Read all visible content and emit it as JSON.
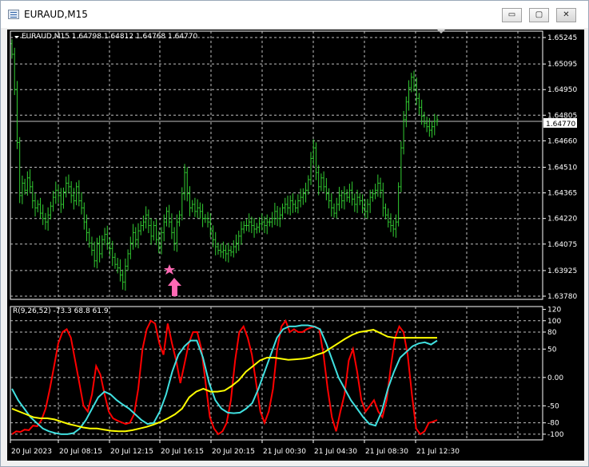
{
  "window": {
    "title": "EURAUD,M15"
  },
  "title_buttons": {
    "minimize": "▭",
    "maximize": "▢",
    "close": "✕"
  },
  "price_chart": {
    "header": "EURAUD,M15  1.64798 1.64812 1.64768 1.64770",
    "current_price": "1.64770",
    "price_labels": [
      "1.65245",
      "1.65095",
      "1.64950",
      "1.64805",
      "1.64660",
      "1.64510",
      "1.64365",
      "1.64220",
      "1.64075",
      "1.63925",
      "1.63780"
    ],
    "price_min": 1.6378,
    "price_max": 1.65245,
    "series_color": "#32cd32",
    "arrow_color": "#ff69b4",
    "close_series": [
      1.6515,
      1.6495,
      1.6465,
      1.6435,
      1.6442,
      1.6438,
      1.6445,
      1.644,
      1.6432,
      1.6428,
      1.643,
      1.6425,
      1.6422,
      1.642,
      1.6424,
      1.6429,
      1.6434,
      1.6438,
      1.6435,
      1.643,
      1.6437,
      1.6442,
      1.644,
      1.6435,
      1.6432,
      1.644,
      1.6432,
      1.6428,
      1.642,
      1.6414,
      1.6408,
      1.6404,
      1.6398,
      1.6408,
      1.6402,
      1.641,
      1.6413,
      1.6408,
      1.6405,
      1.64,
      1.6396,
      1.6394,
      1.639,
      1.6386,
      1.6395,
      1.6402,
      1.6408,
      1.6414,
      1.641,
      1.6415,
      1.6418,
      1.642,
      1.6424,
      1.6418,
      1.6412,
      1.6418,
      1.641,
      1.6406,
      1.6414,
      1.642,
      1.6426,
      1.642,
      1.6414,
      1.6408,
      1.642,
      1.6424,
      1.6436,
      1.6448,
      1.6436,
      1.6428,
      1.643,
      1.6426,
      1.6428,
      1.6426,
      1.6422,
      1.6422,
      1.642,
      1.6415,
      1.641,
      1.6406,
      1.6404,
      1.6403,
      1.6404,
      1.6402,
      1.6404,
      1.6403,
      1.6406,
      1.6408,
      1.6412,
      1.6416,
      1.6418,
      1.6418,
      1.642,
      1.6418,
      1.6416,
      1.6417,
      1.6419,
      1.642,
      1.6418,
      1.642,
      1.642,
      1.6422,
      1.6426,
      1.6422,
      1.6424,
      1.6428,
      1.643,
      1.6428,
      1.6432,
      1.643,
      1.6428,
      1.6432,
      1.6434,
      1.6436,
      1.6438,
      1.6444,
      1.6456,
      1.6462,
      1.6448,
      1.644,
      1.6445,
      1.644,
      1.6436,
      1.6432,
      1.6428,
      1.6425,
      1.643,
      1.6435,
      1.6432,
      1.6436,
      1.6434,
      1.6438,
      1.6433,
      1.643,
      1.6434,
      1.6432,
      1.6428,
      1.6426,
      1.643,
      1.6434,
      1.6436,
      1.6438,
      1.6442,
      1.6438,
      1.6428,
      1.6424,
      1.642,
      1.6418,
      1.6416,
      1.642,
      1.644,
      1.6462,
      1.6478,
      1.6488,
      1.6496,
      1.6502,
      1.6497,
      1.649,
      1.6485,
      1.648,
      1.6476,
      1.6474,
      1.6472,
      1.6474,
      1.6477,
      1.6478
    ]
  },
  "time_axis": {
    "labels": [
      "20 Jul 2023",
      "20 Jul 08:15",
      "20 Jul 12:15",
      "20 Jul 16:15",
      "20 Jul 20:15",
      "21 Jul 00:30",
      "21 Jul 04:30",
      "21 Jul 08:30",
      "21 Jul 12:30"
    ]
  },
  "indicator": {
    "header": "R(9,26,52) -73.3 68.8 61.9",
    "level_labels": [
      "120",
      "100",
      "80",
      "50",
      "0.00",
      "-50",
      "-80",
      "-100"
    ],
    "level_values": [
      120,
      100,
      80,
      50,
      0,
      -50,
      -80,
      -100
    ],
    "y_min": -110,
    "y_max": 125,
    "series": [
      {
        "color": "#ff0000",
        "values": [
          -100,
          -95,
          -96,
          -92,
          -93,
          -85,
          -86,
          -75,
          -55,
          -20,
          20,
          60,
          80,
          85,
          70,
          30,
          -10,
          -50,
          -60,
          -30,
          20,
          5,
          -30,
          -60,
          -72,
          -76,
          -79,
          -82,
          -80,
          -65,
          -20,
          50,
          85,
          100,
          95,
          60,
          40,
          95,
          60,
          30,
          -10,
          25,
          60,
          80,
          80,
          50,
          -10,
          -70,
          -90,
          -100,
          -95,
          -80,
          -40,
          30,
          80,
          90,
          70,
          40,
          -10,
          -60,
          -80,
          -60,
          -20,
          50,
          90,
          100,
          80,
          85,
          80,
          80,
          85,
          88,
          90,
          85,
          40,
          -20,
          -70,
          -95,
          -60,
          -30,
          30,
          50,
          10,
          -40,
          -60,
          -50,
          -40,
          -60,
          -70,
          -40,
          20,
          70,
          90,
          80,
          40,
          -30,
          -90,
          -100,
          -95,
          -80,
          -78,
          -75
        ]
      },
      {
        "color": "#40e0e0",
        "values": [
          -20,
          -40,
          -55,
          -70,
          -80,
          -90,
          -95,
          -98,
          -100,
          -100,
          -98,
          -90,
          -75,
          -55,
          -35,
          -25,
          -30,
          -40,
          -48,
          -55,
          -65,
          -75,
          -82,
          -80,
          -60,
          -30,
          10,
          40,
          55,
          65,
          65,
          35,
          -10,
          -40,
          -55,
          -62,
          -63,
          -62,
          -55,
          -45,
          -20,
          10,
          40,
          70,
          85,
          90,
          90,
          92,
          92,
          90,
          85,
          60,
          30,
          0,
          -20,
          -40,
          -55,
          -70,
          -82,
          -85,
          -60,
          -20,
          10,
          35,
          45,
          55,
          60,
          62,
          58,
          65
        ]
      },
      {
        "color": "#ffff00",
        "values": [
          -55,
          -60,
          -65,
          -70,
          -72,
          -72,
          -74,
          -78,
          -82,
          -85,
          -88,
          -90,
          -90,
          -92,
          -94,
          -95,
          -95,
          -93,
          -90,
          -87,
          -83,
          -78,
          -72,
          -65,
          -55,
          -35,
          -25,
          -20,
          -25,
          -25,
          -23,
          -15,
          -5,
          10,
          20,
          30,
          35,
          35,
          33,
          31,
          32,
          33,
          35,
          40,
          44,
          52,
          60,
          68,
          75,
          80,
          82,
          84,
          78,
          72,
          70,
          70,
          70,
          70,
          70,
          70,
          70
        ]
      }
    ]
  }
}
